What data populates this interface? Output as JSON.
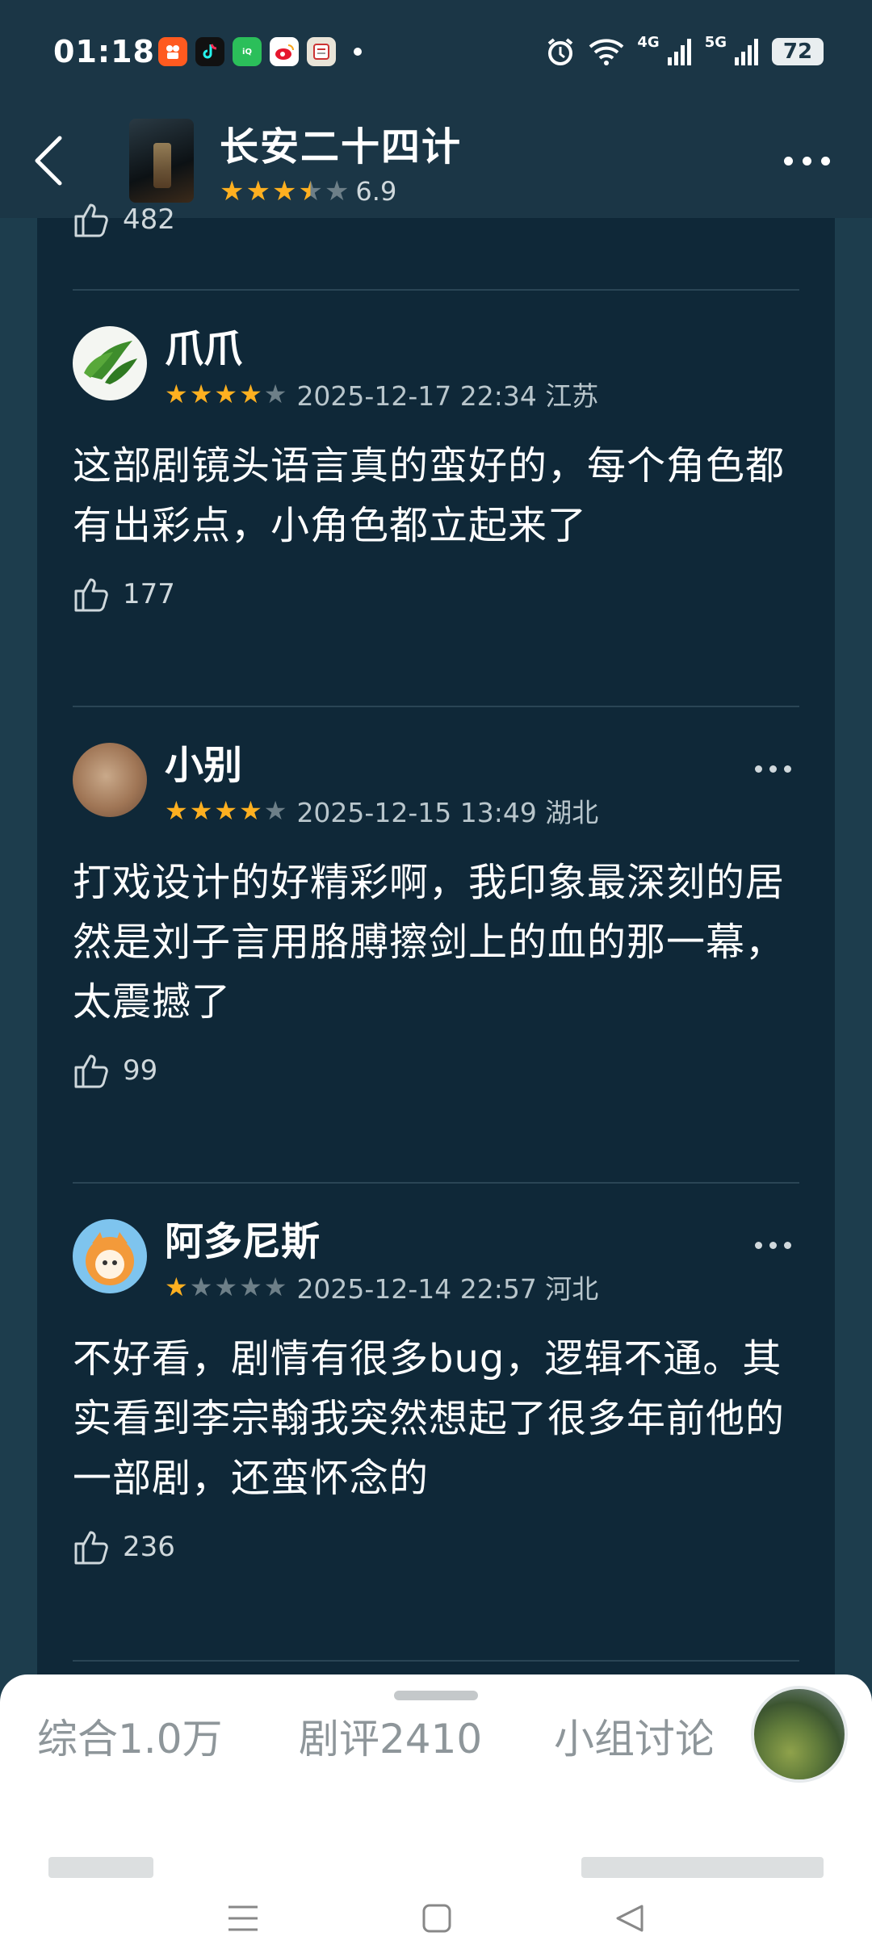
{
  "status_bar": {
    "time": "01:18",
    "apps": [
      {
        "icon": "kuaishou-icon",
        "color": "#ff5a1f"
      },
      {
        "icon": "douyin-icon",
        "color": "#111111"
      },
      {
        "icon": "iqiyi-icon",
        "color": "#2bbf5a"
      },
      {
        "icon": "weibo-icon",
        "color": "#ffffff"
      },
      {
        "icon": "news-app-icon",
        "color": "#e9e4d8"
      }
    ],
    "signal_4g": "4G",
    "signal_5g": "5G",
    "battery": "72"
  },
  "header": {
    "title": "长安二十四计",
    "stars_filled": 3.5,
    "score": "6.9"
  },
  "previous_like_count": "482",
  "reviews": [
    {
      "username": "爪爪",
      "stars": 4,
      "date_location": "2025-12-17 22:34 江苏",
      "text": "这部剧镜头语言真的蛮好的，每个角色都有出彩点，小角色都立起来了",
      "likes": "177"
    },
    {
      "username": "小别",
      "stars": 4,
      "date_location": "2025-12-15 13:49 湖北",
      "text": "打戏设计的好精彩啊，我印象最深刻的居然是刘子言用胳膊擦剑上的血的那一幕，太震撼了",
      "likes": "99"
    },
    {
      "username": "阿多尼斯",
      "stars": 1,
      "date_location": "2025-12-14 22:57 河北",
      "text": "不好看，剧情有很多bug，逻辑不通。其实看到李宗翰我突然想起了很多年前他的一部剧，还蛮怀念的",
      "likes": "236"
    }
  ],
  "bottom_tabs": [
    "综合1.0万",
    "剧评2410",
    "小组讨论"
  ],
  "colors": {
    "star_on": "#ffb020",
    "star_off": "#6d7f88",
    "background": "#1d3d4d",
    "panel": "#0f2838"
  }
}
